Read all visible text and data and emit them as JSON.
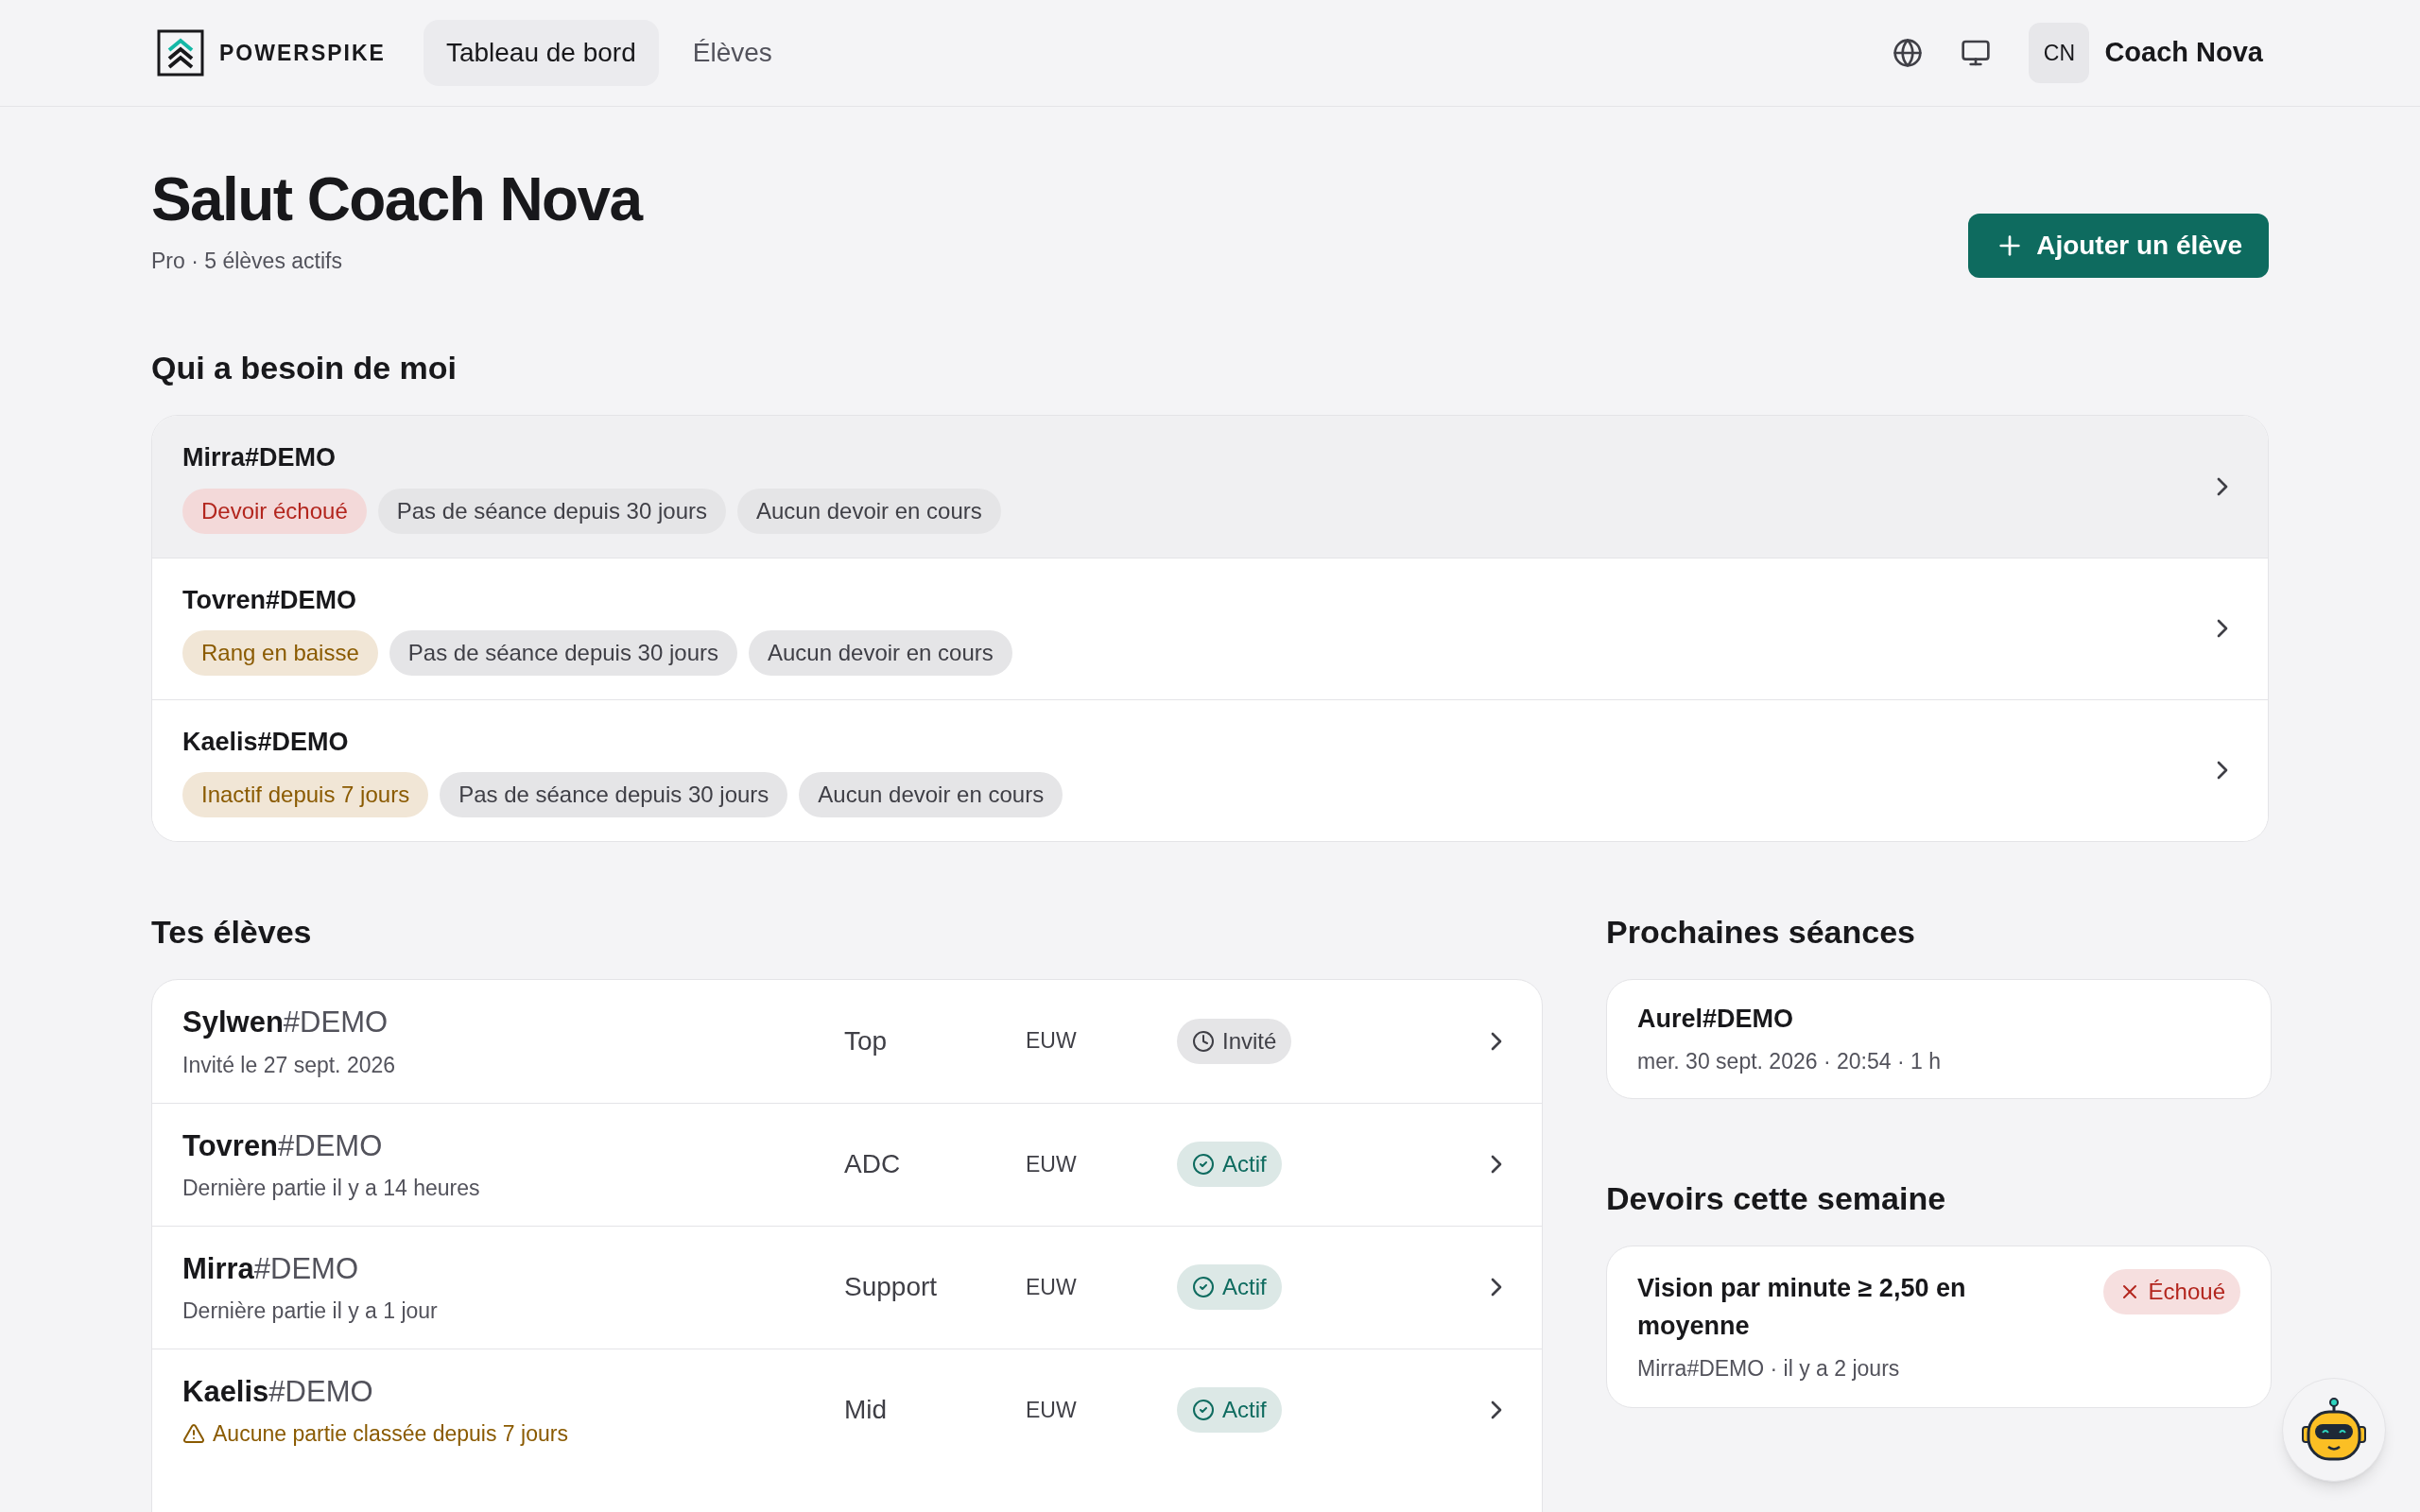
{
  "header": {
    "logo_text": "POWERSPIKE",
    "nav": [
      {
        "label": "Tableau de bord",
        "selected": true
      },
      {
        "label": "Élèves",
        "selected": false
      }
    ],
    "avatar_initials": "CN",
    "user_name": "Coach Nova"
  },
  "hero": {
    "title": "Salut Coach Nova",
    "subtitle": "Pro · 5 élèves actifs",
    "add_button": "Ajouter un élève"
  },
  "needs": {
    "title": "Qui a besoin de moi",
    "items": [
      {
        "name": "Mirra#DEMO",
        "selected": true,
        "tags": [
          {
            "label": "Devoir échoué",
            "kind": "danger"
          },
          {
            "label": "Pas de séance depuis 30 jours",
            "kind": "neutral"
          },
          {
            "label": "Aucun devoir en cours",
            "kind": "neutral"
          }
        ]
      },
      {
        "name": "Tovren#DEMO",
        "selected": false,
        "tags": [
          {
            "label": "Rang en baisse",
            "kind": "warning"
          },
          {
            "label": "Pas de séance depuis 30 jours",
            "kind": "neutral"
          },
          {
            "label": "Aucun devoir en cours",
            "kind": "neutral"
          }
        ]
      },
      {
        "name": "Kaelis#DEMO",
        "selected": false,
        "tags": [
          {
            "label": "Inactif depuis 7 jours",
            "kind": "warning"
          },
          {
            "label": "Pas de séance depuis 30 jours",
            "kind": "neutral"
          },
          {
            "label": "Aucun devoir en cours",
            "kind": "neutral"
          }
        ]
      }
    ]
  },
  "students": {
    "title": "Tes élèves",
    "rows": [
      {
        "name": "Sylwen",
        "tag": "#DEMO",
        "subtitle": "Invité le 27 sept. 2026",
        "warning": false,
        "role": "Top",
        "region": "EUW",
        "status": {
          "label": "Invité",
          "kind": "invited"
        }
      },
      {
        "name": "Tovren",
        "tag": "#DEMO",
        "subtitle": "Dernière partie il y a 14 heures",
        "warning": false,
        "role": "ADC",
        "region": "EUW",
        "status": {
          "label": "Actif",
          "kind": "active"
        }
      },
      {
        "name": "Mirra",
        "tag": "#DEMO",
        "subtitle": "Dernière partie il y a 1 jour",
        "warning": false,
        "role": "Support",
        "region": "EUW",
        "status": {
          "label": "Actif",
          "kind": "active"
        }
      },
      {
        "name": "Kaelis",
        "tag": "#DEMO",
        "subtitle": "Aucune partie classée depuis 7 jours",
        "warning": true,
        "role": "Mid",
        "region": "EUW",
        "status": {
          "label": "Actif",
          "kind": "active"
        }
      }
    ]
  },
  "sessions": {
    "title": "Prochaines séances",
    "items": [
      {
        "name": "Aurel#DEMO",
        "detail": "mer. 30 sept. 2026 · 20:54 · 1 h"
      }
    ]
  },
  "homework": {
    "title": "Devoirs cette semaine",
    "items": [
      {
        "title": "Vision par minute ≥ 2,50 en moyenne",
        "meta": "Mirra#DEMO · il y a 2 jours",
        "status": {
          "label": "Échoué",
          "kind": "failed"
        }
      }
    ]
  }
}
